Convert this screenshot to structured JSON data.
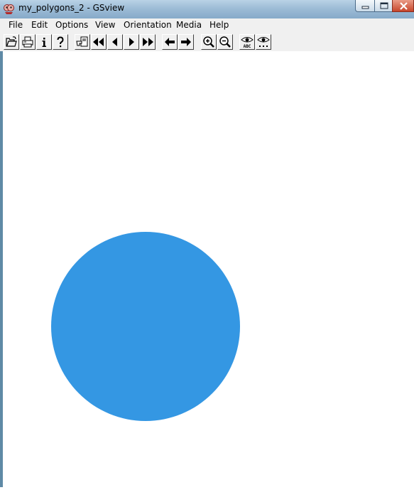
{
  "window": {
    "title": "my_polygons_2 - GSview"
  },
  "menu": [
    "File",
    "Edit",
    "Options",
    "View",
    "Orientation",
    "Media",
    "Help"
  ],
  "toolbar": {
    "buttons": [
      "open",
      "print",
      "info",
      "help",
      "goto-page",
      "first-page",
      "prev-page",
      "next-page",
      "last-page",
      "back",
      "forward",
      "zoom-in",
      "zoom-out",
      "show-text",
      "show-all"
    ],
    "text_labels": {
      "show_text": "ABC"
    }
  },
  "document": {
    "shapes": [
      {
        "type": "circle",
        "fill": "#3497e3"
      }
    ]
  },
  "colors": {
    "title_bar": "#9dbcd6",
    "menu_bar": "#f0f0f0",
    "page": "#ffffff",
    "circle_fill": "#3497e3",
    "close_button": "#c7462b"
  }
}
